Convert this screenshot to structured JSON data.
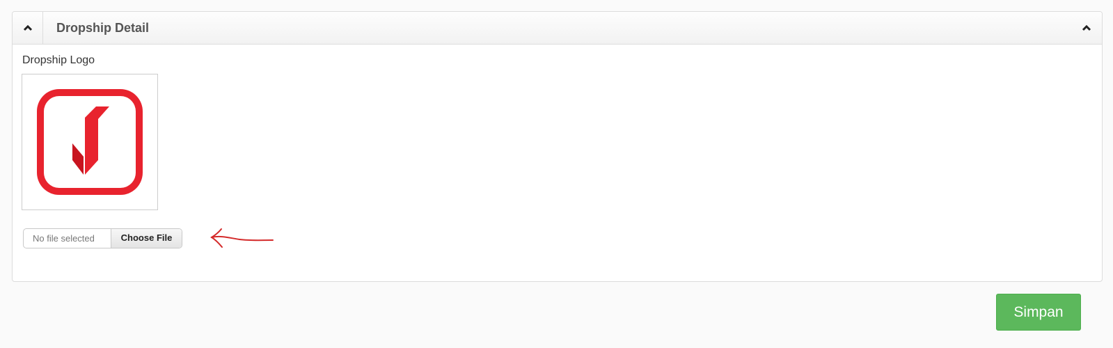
{
  "panel": {
    "title": "Dropship Detail",
    "collapse_icon": "chevron-up-icon"
  },
  "logo_field": {
    "label": "Dropship Logo",
    "logo_colors": {
      "primary": "#e8232e",
      "dark": "#c8141f"
    }
  },
  "file_input": {
    "status": "No file selected",
    "button_label": "Choose File"
  },
  "annotation": {
    "icon": "hand-drawn-arrow-icon",
    "color": "#d42a2a"
  },
  "actions": {
    "save_label": "Simpan",
    "save_color": "#5cb85c"
  }
}
